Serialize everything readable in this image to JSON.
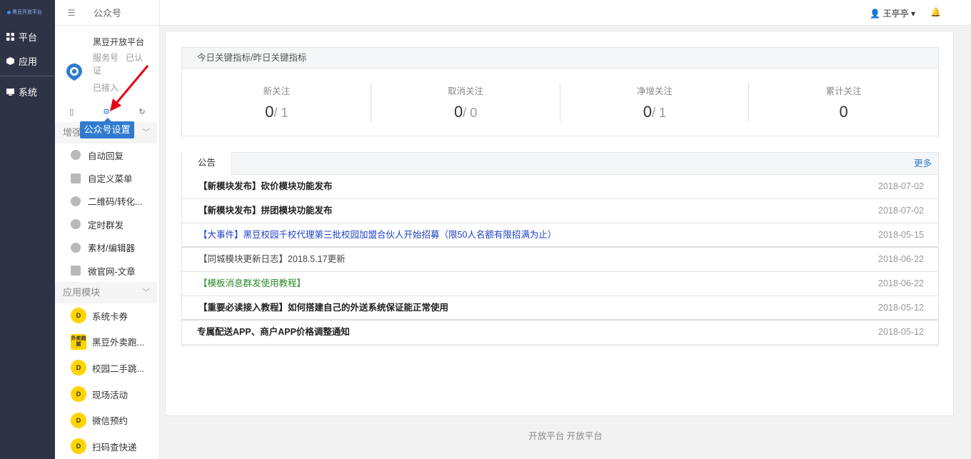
{
  "nav": {
    "logo_text": "黑豆开放平台",
    "items": [
      {
        "label": "平台",
        "icon": "grid-icon"
      },
      {
        "label": "应用",
        "icon": "cube-icon"
      },
      {
        "label": "系统",
        "icon": "monitor-icon"
      }
    ]
  },
  "sidebar": {
    "header_title": "公众号",
    "account": {
      "name": "黑豆开放平台",
      "type": "服务号",
      "verified": "已认证",
      "status": "已接入"
    },
    "tooltip": "公众号设置",
    "group1": {
      "title": "增强"
    },
    "group1_items": [
      {
        "label": "自动回复"
      },
      {
        "label": "自定义菜单"
      },
      {
        "label": "二维码/转化..."
      },
      {
        "label": "定时群发"
      },
      {
        "label": "素材/编辑器"
      },
      {
        "label": "微官网-文章"
      }
    ],
    "group2": {
      "title": "应用模块"
    },
    "group2_items": [
      {
        "label": "系统卡券",
        "badge": "D"
      },
      {
        "label": "黑豆外卖跑...",
        "badge": "外卖跑腿"
      },
      {
        "label": "校园二手跳...",
        "badge": "D"
      },
      {
        "label": "现场活动",
        "badge": "D"
      },
      {
        "label": "微信预约",
        "badge": "D"
      },
      {
        "label": "扫码查快递",
        "badge": "D"
      }
    ]
  },
  "topbar": {
    "user": "王亭亭",
    "user_caret": "▾"
  },
  "stats": {
    "title": "今日关键指标/昨日关键指标",
    "items": [
      {
        "label": "新关注",
        "today": "0",
        "yesterday": "/ 1"
      },
      {
        "label": "取消关注",
        "today": "0",
        "yesterday": "/ 0"
      },
      {
        "label": "净增关注",
        "today": "0",
        "yesterday": "/ 1"
      },
      {
        "label": "累计关注",
        "today": "0",
        "yesterday": ""
      }
    ]
  },
  "notice": {
    "tab": "公告",
    "more": "更多",
    "rows": [
      {
        "title": "【新模块发布】砍价模块功能发布",
        "date": "2018-07-02",
        "style": "bold"
      },
      {
        "title": "【新模块发布】拼团模块功能发布",
        "date": "2018-07-02",
        "style": "bold"
      },
      {
        "title": "【大事件】黑豆校园千校代理第三批校园加盟合伙人开始招募（限50人名额有限招满为止）",
        "date": "2018-05-15",
        "style": "blue"
      },
      {
        "title": "【同城模块更新日志】2018.5.17更新",
        "date": "2018-06-22",
        "style": "plain"
      },
      {
        "title": "【模板消息群发使用教程】",
        "date": "2018-06-22",
        "style": "green"
      },
      {
        "title": "【重要必读接入教程】如何搭建自己的外送系统保证能正常使用",
        "date": "2018-05-12",
        "style": "bold"
      },
      {
        "title": "专属配送APP、商户APP价格调整通知",
        "date": "2018-05-12",
        "style": "bold"
      }
    ]
  },
  "footer": {
    "text": "开放平台 开放平台"
  },
  "colors": {
    "nav_bg": "#2f3346",
    "accent": "#2f7bd0",
    "app_badge": "#ffd400",
    "annotation": "#e60012"
  }
}
